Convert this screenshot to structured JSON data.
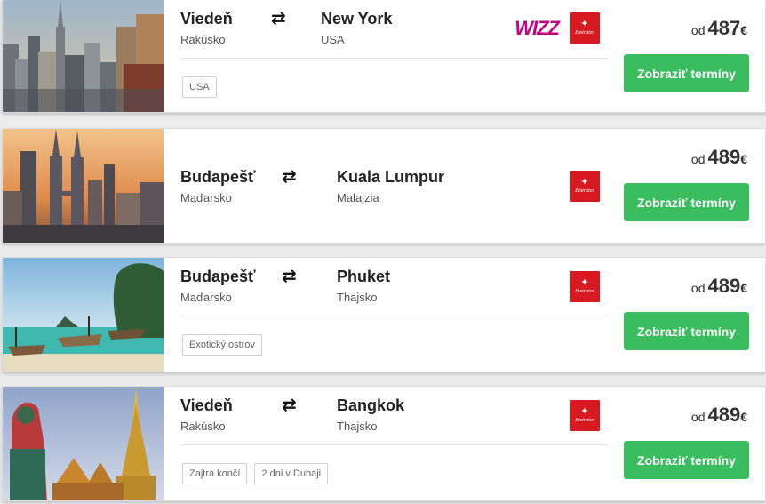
{
  "offers": [
    {
      "from_city": "Viedeň",
      "from_country": "Rakúsko",
      "to_city": "New York",
      "to_country": "USA",
      "arrows": "⇄",
      "airlines": [
        "wizz-air-logo",
        "emirates-logo"
      ],
      "wizz_text": "WIZZ",
      "emirates_text": "Emirates",
      "tags": [
        "USA"
      ],
      "price_prefix": "od",
      "price": "487",
      "currency": "€",
      "button_label": "Zobraziť termíny",
      "photo": "new-york-skyline"
    },
    {
      "from_city": "Budapešť",
      "from_country": "Maďarsko",
      "to_city": "Kuala Lumpur",
      "to_country": "Malajzia",
      "arrows": "⇄",
      "airlines": [
        "emirates-logo"
      ],
      "emirates_text": "Emirates",
      "tags": [],
      "price_prefix": "od",
      "price": "489",
      "currency": "€",
      "button_label": "Zobraziť termíny",
      "photo": "kuala-lumpur-towers"
    },
    {
      "from_city": "Budapešť",
      "from_country": "Maďarsko",
      "to_city": "Phuket",
      "to_country": "Thajsko",
      "arrows": "⇄",
      "airlines": [
        "emirates-logo"
      ],
      "emirates_text": "Emirates",
      "tags": [
        "Exotický ostrov"
      ],
      "price_prefix": "od",
      "price": "489",
      "currency": "€",
      "button_label": "Zobraziť termíny",
      "photo": "phuket-longtail-boats"
    },
    {
      "from_city": "Viedeň",
      "from_country": "Rakúsko",
      "to_city": "Bangkok",
      "to_country": "Thajsko",
      "arrows": "⇄",
      "airlines": [
        "emirates-logo"
      ],
      "emirates_text": "Emirates",
      "tags": [
        "Zajtra končí",
        "2 dni v Dubaji"
      ],
      "price_prefix": "od",
      "price": "489",
      "currency": "€",
      "button_label": "Zobraziť termíny",
      "photo": "bangkok-temple"
    }
  ],
  "colors": {
    "button": "#39bd5f",
    "emirates": "#d71921",
    "wizz": "#c6007e"
  }
}
